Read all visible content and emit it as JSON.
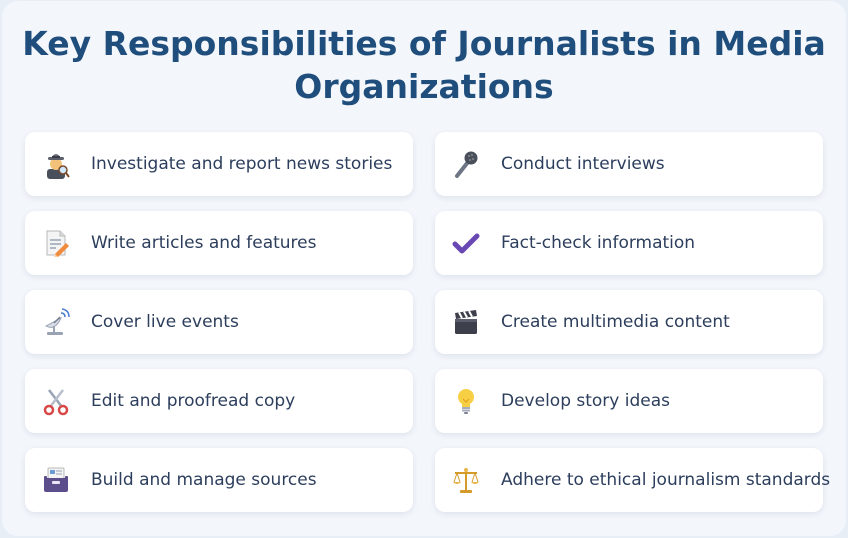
{
  "title": "Key Responsibilities of Journalists in Media Organizations",
  "responsibilities": [
    {
      "label": "Investigate and report news stories",
      "icon": "detective-icon"
    },
    {
      "label": "Conduct interviews",
      "icon": "microphone-icon"
    },
    {
      "label": "Write articles and features",
      "icon": "memo-icon"
    },
    {
      "label": "Fact-check information",
      "icon": "check-mark-icon"
    },
    {
      "label": "Cover live events",
      "icon": "satellite-antenna-icon"
    },
    {
      "label": "Create multimedia content",
      "icon": "clapper-board-icon"
    },
    {
      "label": "Edit and proofread copy",
      "icon": "scissors-icon"
    },
    {
      "label": "Develop story ideas",
      "icon": "light-bulb-icon"
    },
    {
      "label": "Build and manage sources",
      "icon": "card-index-icon"
    },
    {
      "label": "Adhere to ethical journalism standards",
      "icon": "balance-scale-icon"
    }
  ],
  "colors": {
    "title": "#1f4e7d",
    "text": "#2c3e5c",
    "card": "#ffffff",
    "background": "#f3f6fb"
  }
}
